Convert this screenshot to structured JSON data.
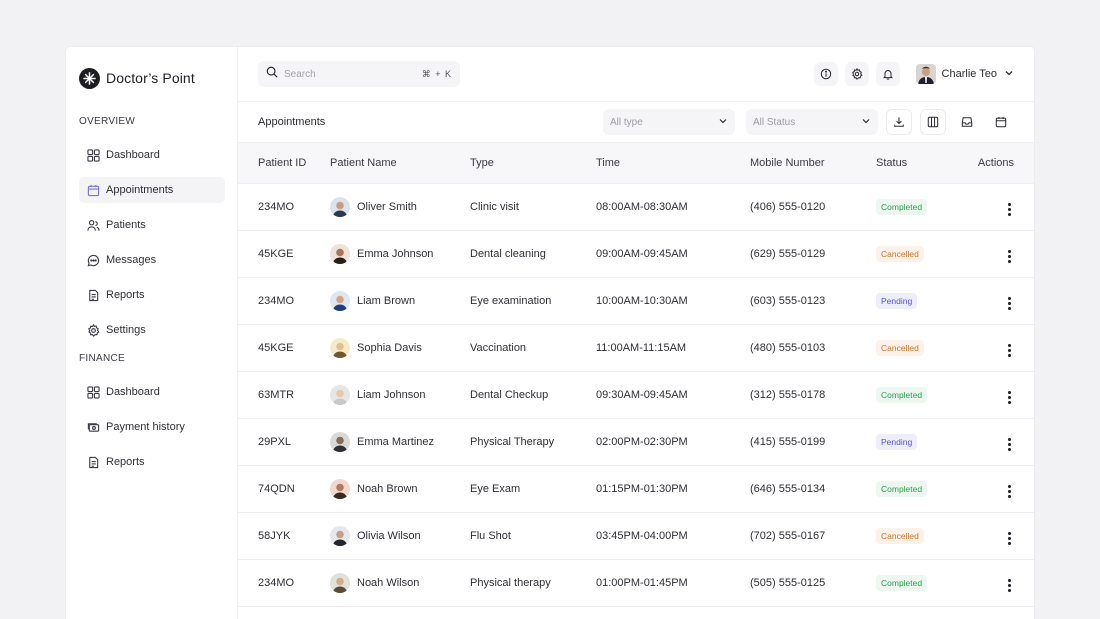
{
  "brand": {
    "name": "Doctor’s Point"
  },
  "sidebar": {
    "overview_label": "OVERVIEW",
    "overview_items": [
      {
        "label": "Dashboard",
        "icon": "grid-icon"
      },
      {
        "label": "Appointments",
        "icon": "calendar-icon",
        "active": true
      },
      {
        "label": "Patients",
        "icon": "patients-icon"
      },
      {
        "label": "Messages",
        "icon": "chat-icon"
      },
      {
        "label": "Reports",
        "icon": "report-icon"
      },
      {
        "label": "Settings",
        "icon": "gear-icon"
      }
    ],
    "finance_label": "FINANCE",
    "finance_items": [
      {
        "label": "Dashboard",
        "icon": "grid-icon"
      },
      {
        "label": "Payment history",
        "icon": "payment-icon"
      },
      {
        "label": "Reports",
        "icon": "report-icon"
      }
    ]
  },
  "topbar": {
    "search_placeholder": "Search",
    "shortcut": "⌘ + K",
    "user_name": "Charlie Teo"
  },
  "toolbar": {
    "title": "Appointments",
    "type_filter": "All type",
    "status_filter": "All Status"
  },
  "table": {
    "headers": {
      "patient_id": "Patient ID",
      "patient_name": "Patient Name",
      "type": "Type",
      "time": "Time",
      "mobile": "Mobile Number",
      "status": "Status",
      "actions": "Actions"
    },
    "rows": [
      {
        "id": "234MO",
        "name": "Oliver Smith",
        "type": "Clinic visit",
        "time": "08:00AM-08:30AM",
        "mobile": "(406) 555-0120",
        "status": "Completed",
        "status_class": "completed"
      },
      {
        "id": "45KGE",
        "name": "Emma Johnson",
        "type": "Dental cleaning",
        "time": "09:00AM-09:45AM",
        "mobile": "(629) 555-0129",
        "status": "Cancelled",
        "status_class": "cancelled"
      },
      {
        "id": "234MO",
        "name": "Liam Brown",
        "type": "Eye examination",
        "time": "10:00AM-10:30AM",
        "mobile": "(603) 555-0123",
        "status": "Pending",
        "status_class": "pending"
      },
      {
        "id": "45KGE",
        "name": "Sophia Davis",
        "type": "Vaccination",
        "time": "11:00AM-11:15AM",
        "mobile": "(480) 555-0103",
        "status": "Cancelled",
        "status_class": "cancelled"
      },
      {
        "id": "63MTR",
        "name": "Liam Johnson",
        "type": "Dental Checkup",
        "time": "09:30AM-09:45AM",
        "mobile": "(312) 555-0178",
        "status": "Completed",
        "status_class": "completed"
      },
      {
        "id": "29PXL",
        "name": "Emma Martinez",
        "type": "Physical Therapy",
        "time": "02:00PM-02:30PM",
        "mobile": "(415) 555-0199",
        "status": "Pending",
        "status_class": "pending"
      },
      {
        "id": "74QDN",
        "name": "Noah Brown",
        "type": "Eye Exam",
        "time": "01:15PM-01:30PM",
        "mobile": "(646) 555-0134",
        "status": "Completed",
        "status_class": "completed"
      },
      {
        "id": "58JYK",
        "name": "Olivia Wilson",
        "type": "Flu Shot",
        "time": "03:45PM-04:00PM",
        "mobile": "(702) 555-0167",
        "status": "Cancelled",
        "status_class": "cancelled"
      },
      {
        "id": "234MO",
        "name": "Noah Wilson",
        "type": "Physical therapy",
        "time": "01:00PM-01:45PM",
        "mobile": "(505) 555-0125",
        "status": "Completed",
        "status_class": "completed"
      }
    ]
  },
  "colors": {
    "completed": "#2f9e4f",
    "cancelled": "#c6732a",
    "pending": "#5a53c7",
    "accent": "#6b63d6"
  }
}
